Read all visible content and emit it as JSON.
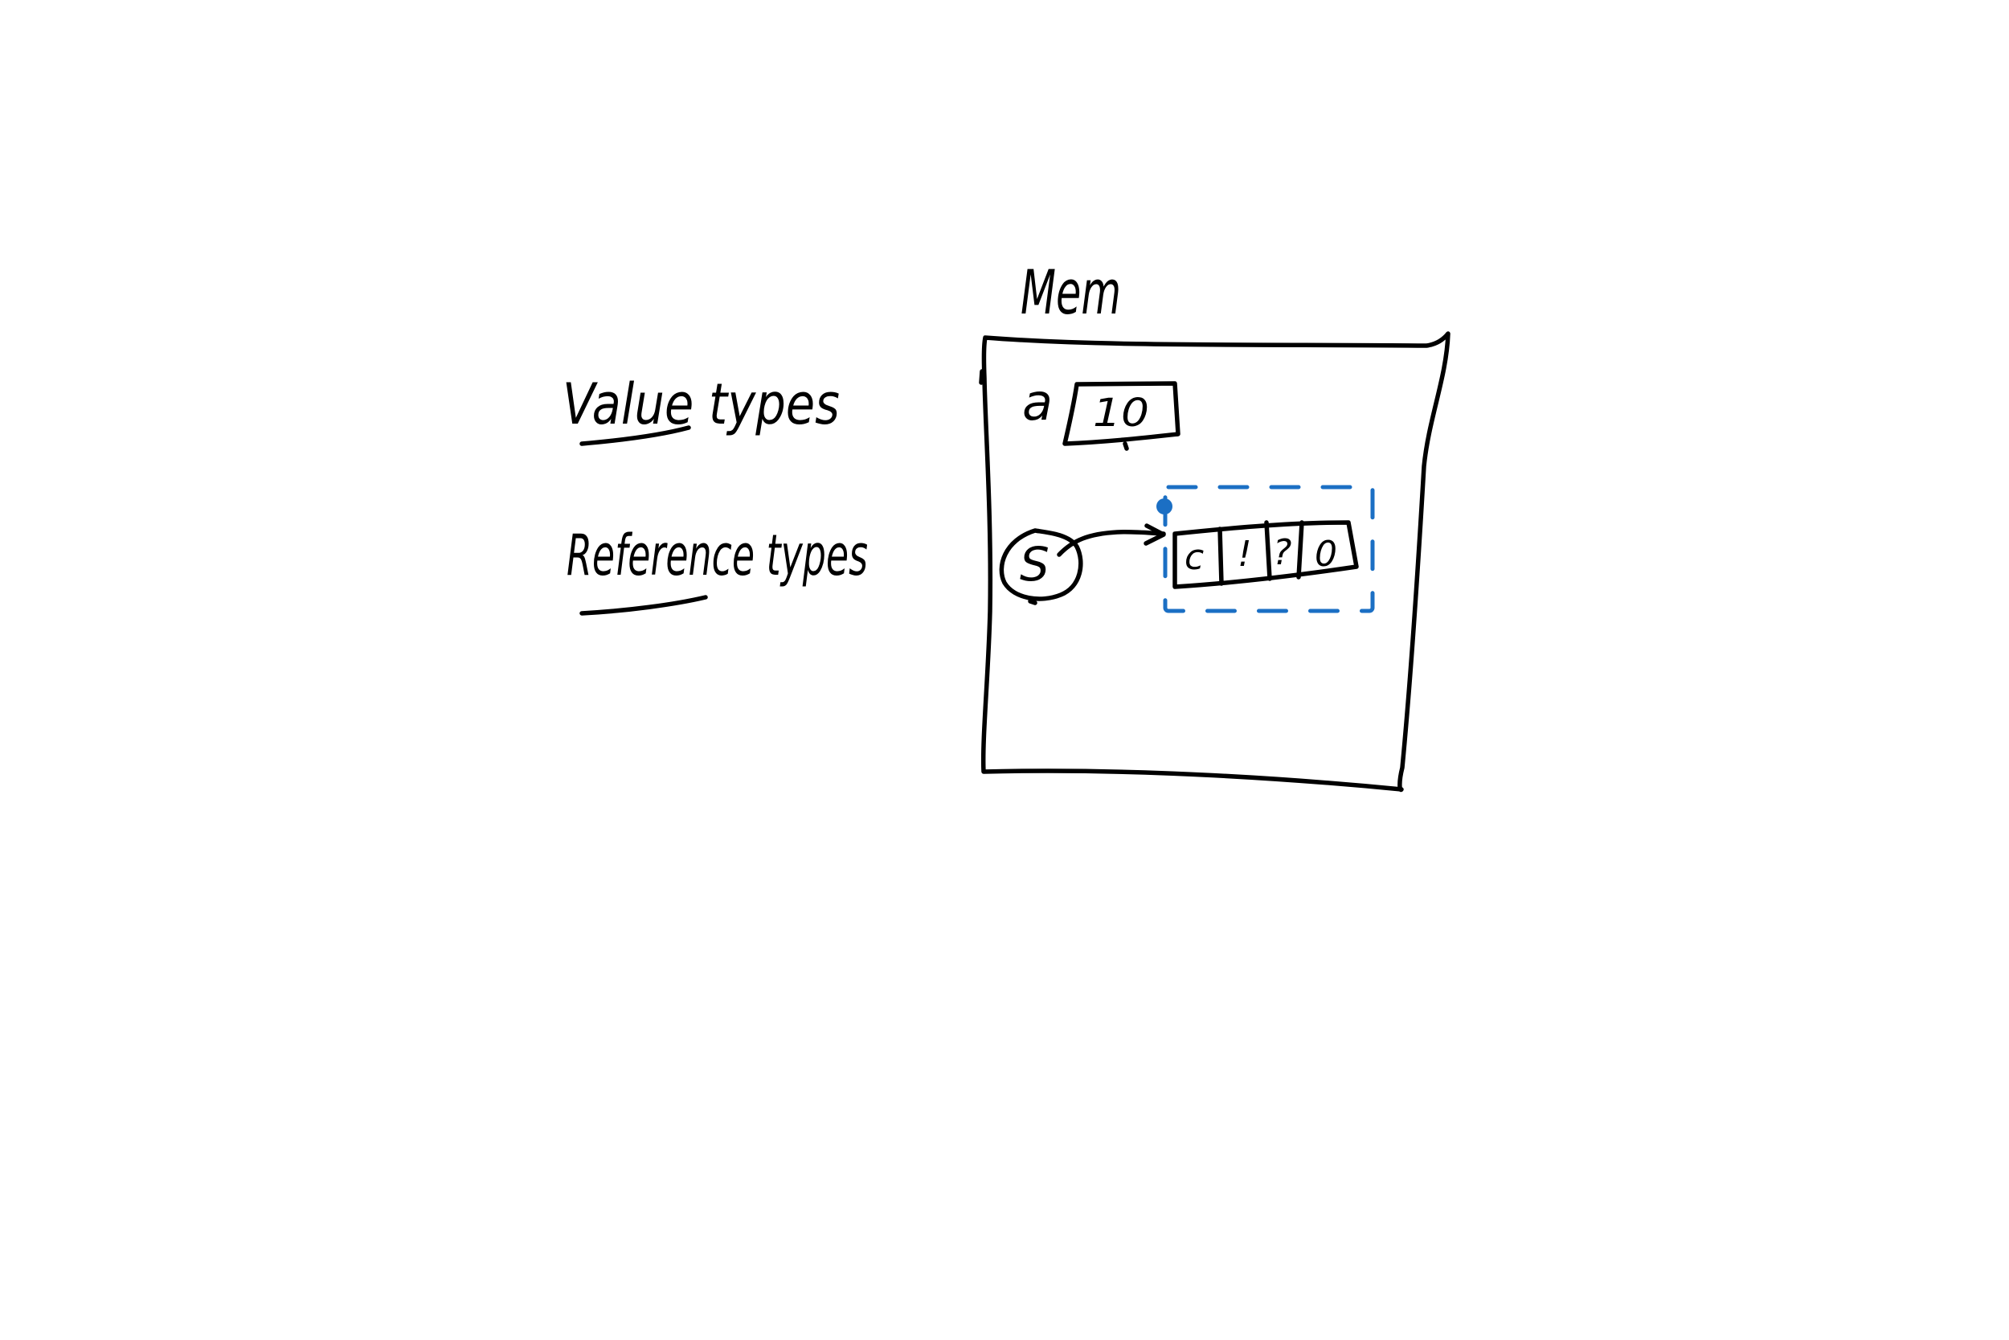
{
  "labels": {
    "memory": "Mem",
    "value_types": "Value types",
    "reference_types": "Reference types"
  },
  "value_variable": {
    "name": "a",
    "value": "10"
  },
  "reference_variable": {
    "name": "S",
    "chars": [
      "c",
      "!",
      "?",
      "0"
    ]
  },
  "colors": {
    "ink": "#000000",
    "selection": "#1b6fc4",
    "background": "#ffffff"
  }
}
